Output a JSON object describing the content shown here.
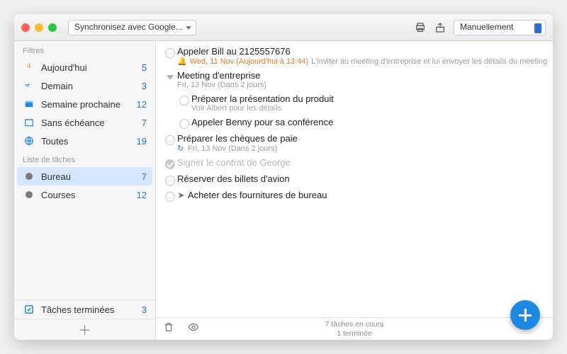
{
  "toolbar": {
    "sync_label": "Synchronisez avec Google...",
    "sort_label": "Manuellement"
  },
  "sidebar": {
    "filters_header": "Filtres",
    "lists_header": "Liste de tâches",
    "filters": [
      {
        "label": "Aujourd'hui",
        "count": 5,
        "color": "#f39c12",
        "icon": "down-arrow"
      },
      {
        "label": "Demain",
        "count": 3,
        "color": "#1e88e5",
        "icon": "right-arrow"
      },
      {
        "label": "Semaine prochaine",
        "count": 12,
        "color": "#1e88e5",
        "icon": "week"
      },
      {
        "label": "Sans échéance",
        "count": 7,
        "color": "#1e88e5",
        "icon": "nodate"
      },
      {
        "label": "Toutes",
        "count": 19,
        "color": "#1e88e5",
        "icon": "globe"
      }
    ],
    "lists": [
      {
        "label": "Bureau",
        "count": 7,
        "selected": true
      },
      {
        "label": "Courses",
        "count": 12,
        "selected": false
      }
    ],
    "completed": {
      "label": "Tâches terminées",
      "count": 3
    }
  },
  "tasks": [
    {
      "title": "Appeler Bill au 2125557676",
      "due": "Wed, 11 Nov (Aujourd'hui à 13:44)",
      "note": "L'inviter au meeting d'entreprise et lui envoyer les détails du meeting à bill@gmail.c",
      "reminder": true
    },
    {
      "title": "Meeting d'entreprise",
      "group": true,
      "sub_date": "Fri, 13 Nov (Dans 2 jours)",
      "children": [
        {
          "title": "Préparer la présentation du produit",
          "note": "Voir Albert pour les détails"
        },
        {
          "title": "Appeler Benny pour sa conférence"
        }
      ]
    },
    {
      "title": "Préparer les chèques de paie",
      "repeat": true,
      "sub_date": "Fri, 13 Nov (Dans 2 jours)"
    },
    {
      "title": "Signer le contrat de George",
      "done": true
    },
    {
      "title": "Réserver des billets d'avion"
    },
    {
      "title": "Acheter des fournitures de bureau",
      "location": true
    }
  ],
  "footer": {
    "line1": "7 tâches en cours",
    "line2": "1 terminée"
  }
}
